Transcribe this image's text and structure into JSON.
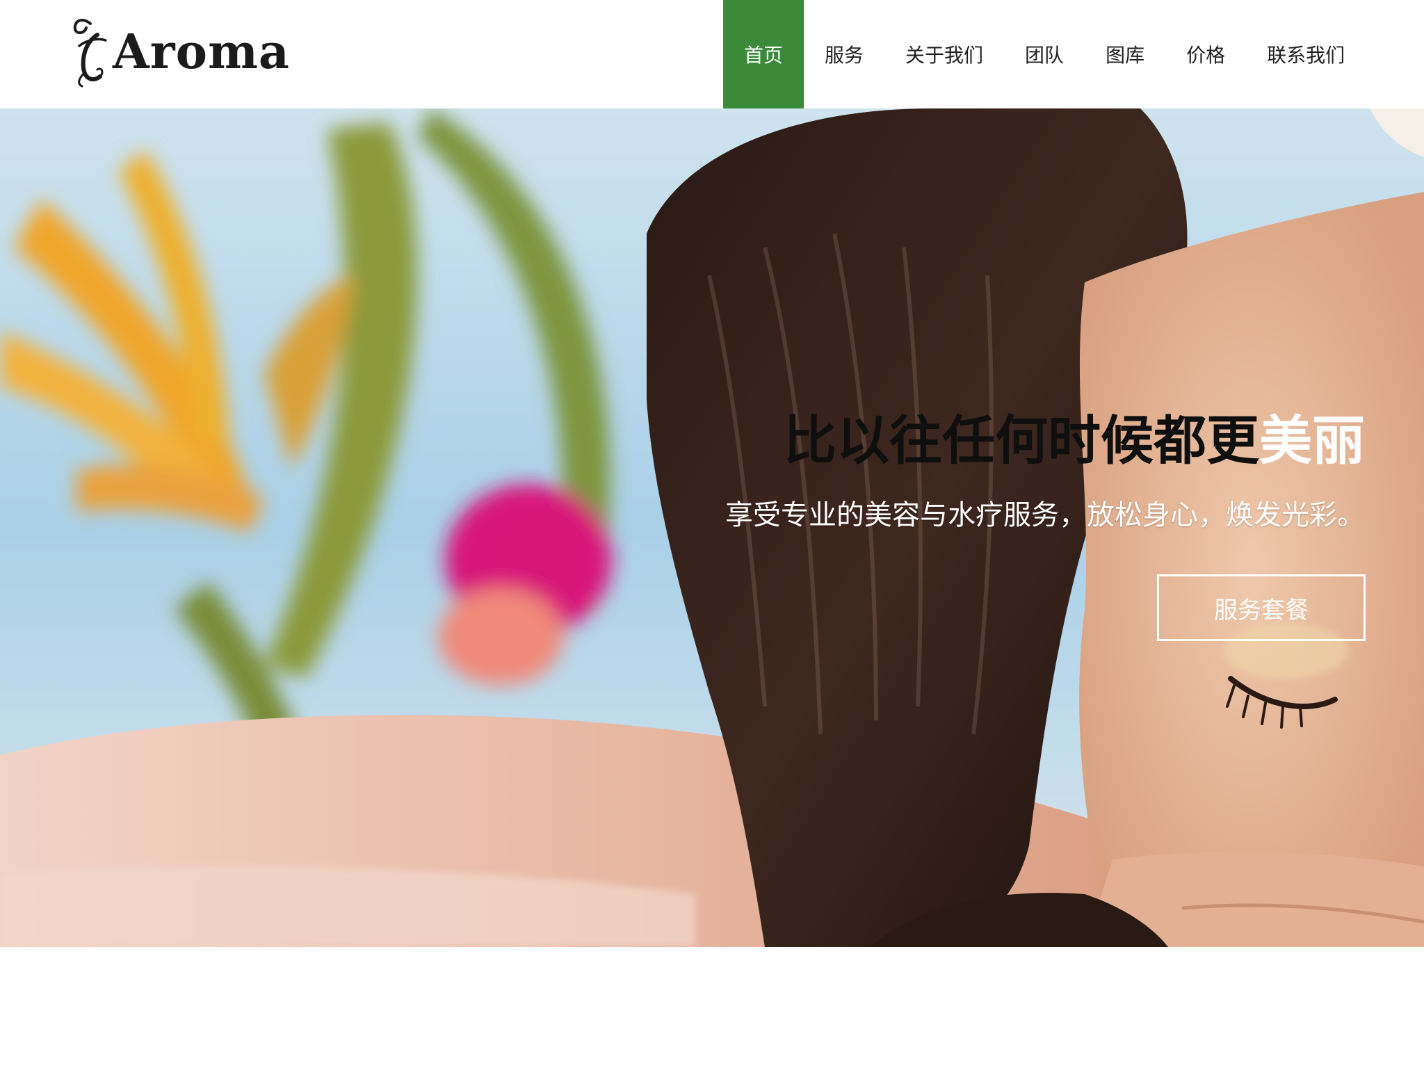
{
  "brand": {
    "name": "Aroma",
    "logo_icon": "ornamental-script-letter"
  },
  "nav": {
    "items": [
      {
        "label": "首页",
        "active": true
      },
      {
        "label": "服务",
        "active": false
      },
      {
        "label": "关于我们",
        "active": false
      },
      {
        "label": "团队",
        "active": false
      },
      {
        "label": "图库",
        "active": false
      },
      {
        "label": "价格",
        "active": false
      },
      {
        "label": "联系我们",
        "active": false
      }
    ],
    "active_color": "#3b8a3a"
  },
  "hero": {
    "title_dark": "比以往任何时候都更",
    "title_light": "美丽",
    "subtitle": "享受专业的美容与水疗服务，放松身心，焕发光彩。",
    "button_label": "服务套餐",
    "background": "spa-woman-resting-with-tropical-flowers"
  }
}
